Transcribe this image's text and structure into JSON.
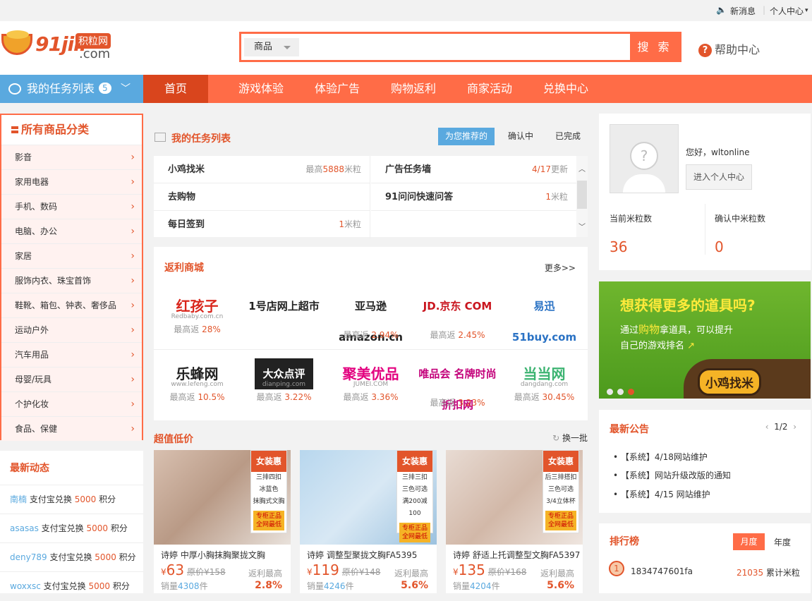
{
  "topbar": {
    "messages": "新消息",
    "personal": "个人中心"
  },
  "logo": {
    "text": "91jili",
    "cn": "积粒网",
    "com": ".com"
  },
  "search": {
    "category": "商品",
    "placeholder": "",
    "button": "搜 索"
  },
  "help": {
    "label": "帮助中心"
  },
  "nav": {
    "task_list": "我的任务列表",
    "task_count": "5",
    "items": [
      "首页",
      "游戏体验",
      "体验广告",
      "购物返利",
      "商家活动",
      "兑换中心"
    ]
  },
  "categories": {
    "title": "所有商品分类",
    "items": [
      "影音",
      "家用电器",
      "手机、数码",
      "电脑、办公",
      "家居",
      "服饰内衣、珠宝首饰",
      "鞋靴、箱包、钟表、奢侈品",
      "运动户外",
      "汽车用品",
      "母婴/玩具",
      "个护化妆",
      "食品、保健"
    ]
  },
  "news": {
    "title": "最新动态",
    "items": [
      {
        "user": "南楠",
        "text": "支付宝兑换",
        "amount": "5000",
        "unit": "积分"
      },
      {
        "user": "asasas",
        "text": "支付宝兑换",
        "amount": "5000",
        "unit": "积分"
      },
      {
        "user": "deny789",
        "text": "支付宝兑换",
        "amount": "5000",
        "unit": "积分"
      },
      {
        "user": "woxxsc",
        "text": "支付宝兑换",
        "amount": "5000",
        "unit": "积分"
      }
    ]
  },
  "tasks": {
    "title": "我的任务列表",
    "tabs": [
      "为您推荐的",
      "确认中",
      "已完成"
    ],
    "items": [
      {
        "name": "小鸡找米",
        "reward_pre": "最高",
        "reward": "5888",
        "reward_post": "米粒"
      },
      {
        "name": "广告任务墙",
        "reward_pre": "",
        "reward": "4/17",
        "reward_post": "更新"
      },
      {
        "name": "去购物",
        "reward_pre": "",
        "reward": "",
        "reward_post": ""
      },
      {
        "name": "91问问快速问答",
        "reward_pre": "",
        "reward": "1",
        "reward_post": "米粒"
      },
      {
        "name": "每日签到",
        "reward_pre": "",
        "reward": "1",
        "reward_post": "米粒"
      }
    ]
  },
  "mall": {
    "title": "返利商城",
    "more": "更多>>",
    "brands": [
      {
        "logo": "红孩子",
        "sub": "Redbaby.com.cn",
        "prefix": "最高返",
        "rate": "28%",
        "color": "#d9261c"
      },
      {
        "logo": "1号店网上超市",
        "sub": "",
        "prefix": "",
        "rate": "",
        "color": "#222222"
      },
      {
        "logo": "亚马逊 amazon.cn",
        "sub": "",
        "prefix": "最高返",
        "rate": "2.94%",
        "color": "#222222"
      },
      {
        "logo": "JD.京东 COM",
        "sub": "",
        "prefix": "最高返",
        "rate": "2.45%",
        "color": "#c9151e"
      },
      {
        "logo": "易迅 51buy.com",
        "sub": "",
        "prefix": "",
        "rate": "",
        "color": "#2a72c4"
      },
      {
        "logo": "乐蜂网",
        "sub": "www.lefeng.com",
        "prefix": "最高返",
        "rate": "10.5%",
        "color": "#222222"
      },
      {
        "logo": "大众点评",
        "sub": "dianping.com",
        "prefix": "最高返",
        "rate": "3.22%",
        "color": "#ffffff"
      },
      {
        "logo": "聚美优品",
        "sub": "JUMEI.COM",
        "prefix": "最高返",
        "rate": "3.36%",
        "color": "#e3007f"
      },
      {
        "logo": "唯品会 名牌时尚折扣网",
        "sub": "",
        "prefix": "最高返",
        "rate": "3.23%",
        "color": "#c3007a"
      },
      {
        "logo": "当当网",
        "sub": "dangdang.com",
        "prefix": "最高返",
        "rate": "30.45%",
        "color": "#3cb371"
      }
    ]
  },
  "deals": {
    "title": "超值低价",
    "refresh": "换一批",
    "items": [
      {
        "tag": "女装惠",
        "lines": [
          "三排四扣",
          "冰蓝色",
          "抹胸式文胸"
        ],
        "guarantee": "专柜正品 全网最低",
        "name": "诗婷 中厚小胸抹胸聚拢文胸",
        "currency": "¥",
        "price": "63",
        "orig_label": "原价",
        "orig": "¥158",
        "fl_label": "返利最高",
        "pct": "2.8%",
        "sold_label": "销量",
        "sold": "4308",
        "sold_unit": "件"
      },
      {
        "tag": "女装惠",
        "lines": [
          "三排三扣",
          "三色可选",
          "满200减100"
        ],
        "guarantee": "专柜正品 全网最低",
        "name": "诗婷 调整型聚拢文胸FA5395",
        "currency": "¥",
        "price": "119",
        "orig_label": "原价",
        "orig": "¥148",
        "fl_label": "返利最高",
        "pct": "5.6%",
        "sold_label": "销量",
        "sold": "4246",
        "sold_unit": "件"
      },
      {
        "tag": "女装惠",
        "lines": [
          "后三排搭扣",
          "三色可选",
          "3/4立体杯"
        ],
        "guarantee": "专柜正品 全网最低",
        "name": "诗婷 舒适上托调整型文胸FA5397",
        "currency": "¥",
        "price": "135",
        "orig_label": "原价",
        "orig": "¥168",
        "fl_label": "返利最高",
        "pct": "5.6%",
        "sold_label": "销量",
        "sold": "4204",
        "sold_unit": "件"
      }
    ]
  },
  "user": {
    "greeting": "您好，wltonline",
    "enter": "进入个人中心",
    "current_label": "当前米粒数",
    "current": "36",
    "pending_label": "确认中米粒数",
    "pending": "0"
  },
  "banner": {
    "headline": "想获得更多的道具吗?",
    "line1_a": "通过",
    "line1_b": "购物",
    "line1_c": "拿道具，可以提升",
    "line2": "自己的游戏排名",
    "game": "小鸡找米"
  },
  "notice": {
    "title": "最新公告",
    "page": "1/2",
    "items": [
      "【系统】4/18网站维护",
      "【系统】网站升级改版的通知",
      "【系统】4/15 网站维护"
    ]
  },
  "rank": {
    "title": "排行榜",
    "tab_month": "月度",
    "tab_year": "年度",
    "items": [
      {
        "pos": "1",
        "user": "1834747601fa",
        "score": "21035",
        "unit": "累计米粒"
      }
    ]
  }
}
